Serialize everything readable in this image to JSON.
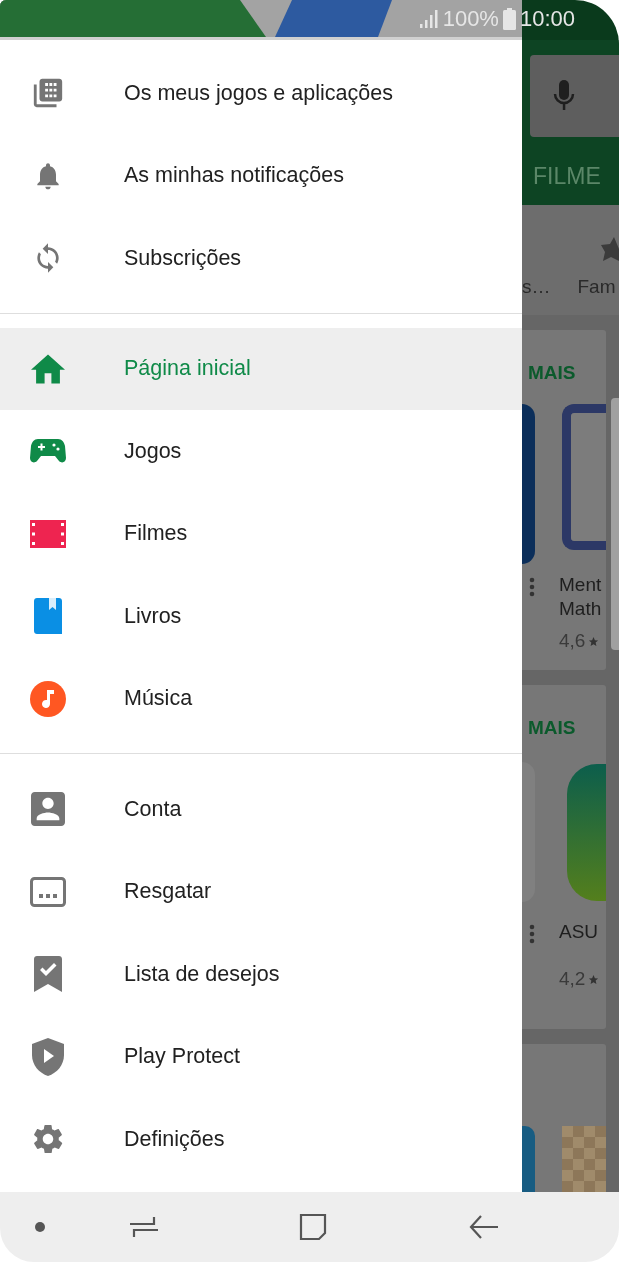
{
  "status_bar": {
    "battery": "100%",
    "time": "10:00"
  },
  "drawer": {
    "sections": [
      [
        {
          "kind": "apps",
          "label": "Os meus jogos e aplicações",
          "selected": false
        },
        {
          "kind": "bell",
          "label": "As minhas notificações",
          "selected": false
        },
        {
          "kind": "sync",
          "label": "Subscrições",
          "selected": false
        }
      ],
      [
        {
          "kind": "home",
          "label": "Página inicial",
          "selected": true
        },
        {
          "kind": "games",
          "label": "Jogos",
          "selected": false
        },
        {
          "kind": "movies",
          "label": "Filmes",
          "selected": false
        },
        {
          "kind": "books",
          "label": "Livros",
          "selected": false
        },
        {
          "kind": "music",
          "label": "Música",
          "selected": false
        }
      ],
      [
        {
          "kind": "account",
          "label": "Conta",
          "selected": false
        },
        {
          "kind": "redeem",
          "label": "Resgatar",
          "selected": false
        },
        {
          "kind": "wishlist",
          "label": "Lista de desejos",
          "selected": false
        },
        {
          "kind": "protect",
          "label": "Play Protect",
          "selected": false
        },
        {
          "kind": "settings",
          "label": "Definições",
          "selected": false
        }
      ]
    ]
  },
  "background_app": {
    "tab": "FILME",
    "categories": [
      "s…",
      "Fam"
    ],
    "cards": [
      {
        "more": "MAIS",
        "title": [
          "Ment",
          "Math"
        ],
        "rating": "4,6"
      },
      {
        "more": "MAIS",
        "title": [
          "ASU"
        ],
        "rating": "4,2"
      }
    ]
  }
}
